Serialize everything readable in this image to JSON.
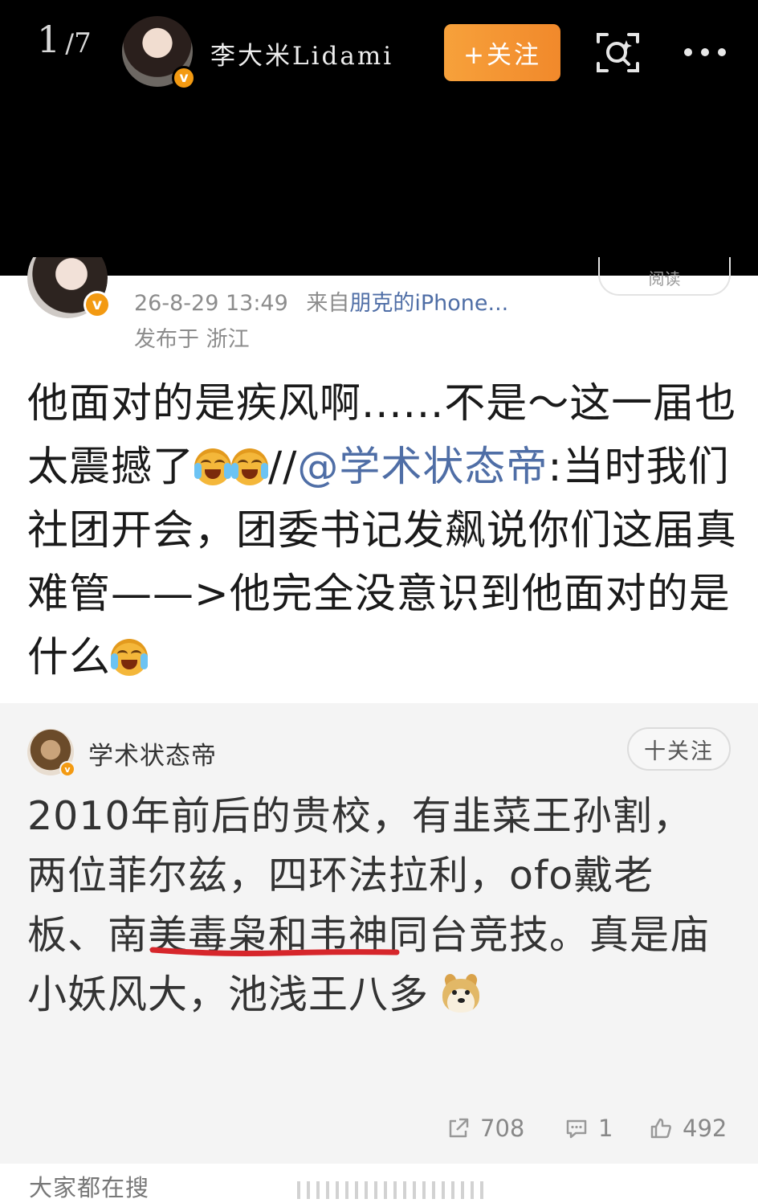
{
  "viewer": {
    "counter_current": "1",
    "counter_separator": "/",
    "counter_total": "7",
    "author_name": "李大米Lidami",
    "follow_label": "+关注"
  },
  "post": {
    "timestamp": "26-8-29 13:49",
    "source_prefix": "来自",
    "source_device": "朋克的iPhone...",
    "location": "发布于 浙江",
    "read_label": "阅读",
    "text_part1": "他面对的是疾风啊......不是～这一届也太震撼了",
    "text_slashes": "//",
    "mention": "@学术状态帝",
    "text_part2": ":当时我们社团开会，团委书记发飙说你们这届真难管——>他完全没意识到他面对的是什么",
    "emoji_name": "laugh-cry-emoji"
  },
  "quote": {
    "author_name": "学术状态帝",
    "follow_label": "十关注",
    "text": "2010年前后的贵校，有韭菜王孙割，两位菲尔兹，四环法拉利，ofo戴老板、南美毒枭和韦神同台竞技。真是庙小妖风大，池浅王八多",
    "underlined_phrase": "南美毒枭",
    "emoji_name": "doge-emoji",
    "shares": "708",
    "comments": "1",
    "likes": "492",
    "underline_color": "#d6262b"
  },
  "bottom": {
    "label": "大家都在搜"
  },
  "colors": {
    "follow_button": "#f39a2f",
    "mention_link": "#4f6ea6",
    "verified_badge": "#f39a12"
  }
}
